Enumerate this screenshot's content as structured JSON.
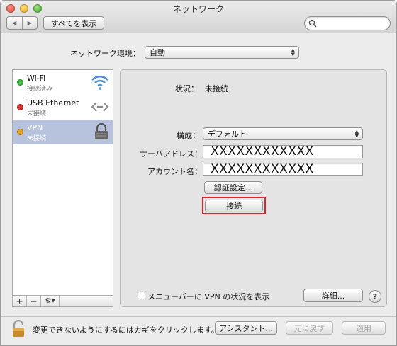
{
  "window": {
    "title": "ネットワーク"
  },
  "toolbar": {
    "show_all_label": "すべてを表示",
    "search_placeholder": ""
  },
  "location": {
    "label": "ネットワーク環境：",
    "value": "自動"
  },
  "services": [
    {
      "name": "Wi-Fi",
      "status": "接続済み",
      "dot_color": "#3cbf3c",
      "icon": "wifi-icon",
      "selected": false
    },
    {
      "name": "USB Ethernet",
      "status": "未接続",
      "dot_color": "#d6332e",
      "icon": "ethernet-icon",
      "selected": false
    },
    {
      "name": "VPN",
      "status": "未接続",
      "dot_color": "#e6a21b",
      "icon": "lock-icon",
      "selected": true
    }
  ],
  "sidebar_controls": {
    "add": "+",
    "remove": "−",
    "gear": "⚙▾"
  },
  "vpn": {
    "status_label": "状況：",
    "status_value": "未接続",
    "config_label": "構成：",
    "config_value": "デフォルト",
    "server_label": "サーバアドレス：",
    "server_value": "XXXXXXXXXXXX",
    "account_label": "アカウント名：",
    "account_value": "XXXXXXXXXXXX",
    "auth_button": "認証設定...",
    "connect_button": "接続",
    "highlight_color": "#d7262b",
    "menubar_checkbox_label": "メニューバーに VPN の状況を表示",
    "menubar_checked": false,
    "advanced_button": "詳細...",
    "help_button": "?"
  },
  "footer": {
    "lock_text": "変更できないようにするにはカギをクリックします。",
    "assistant_button": "アシスタント...",
    "revert_button": "元に戻す",
    "apply_button": "適用"
  }
}
